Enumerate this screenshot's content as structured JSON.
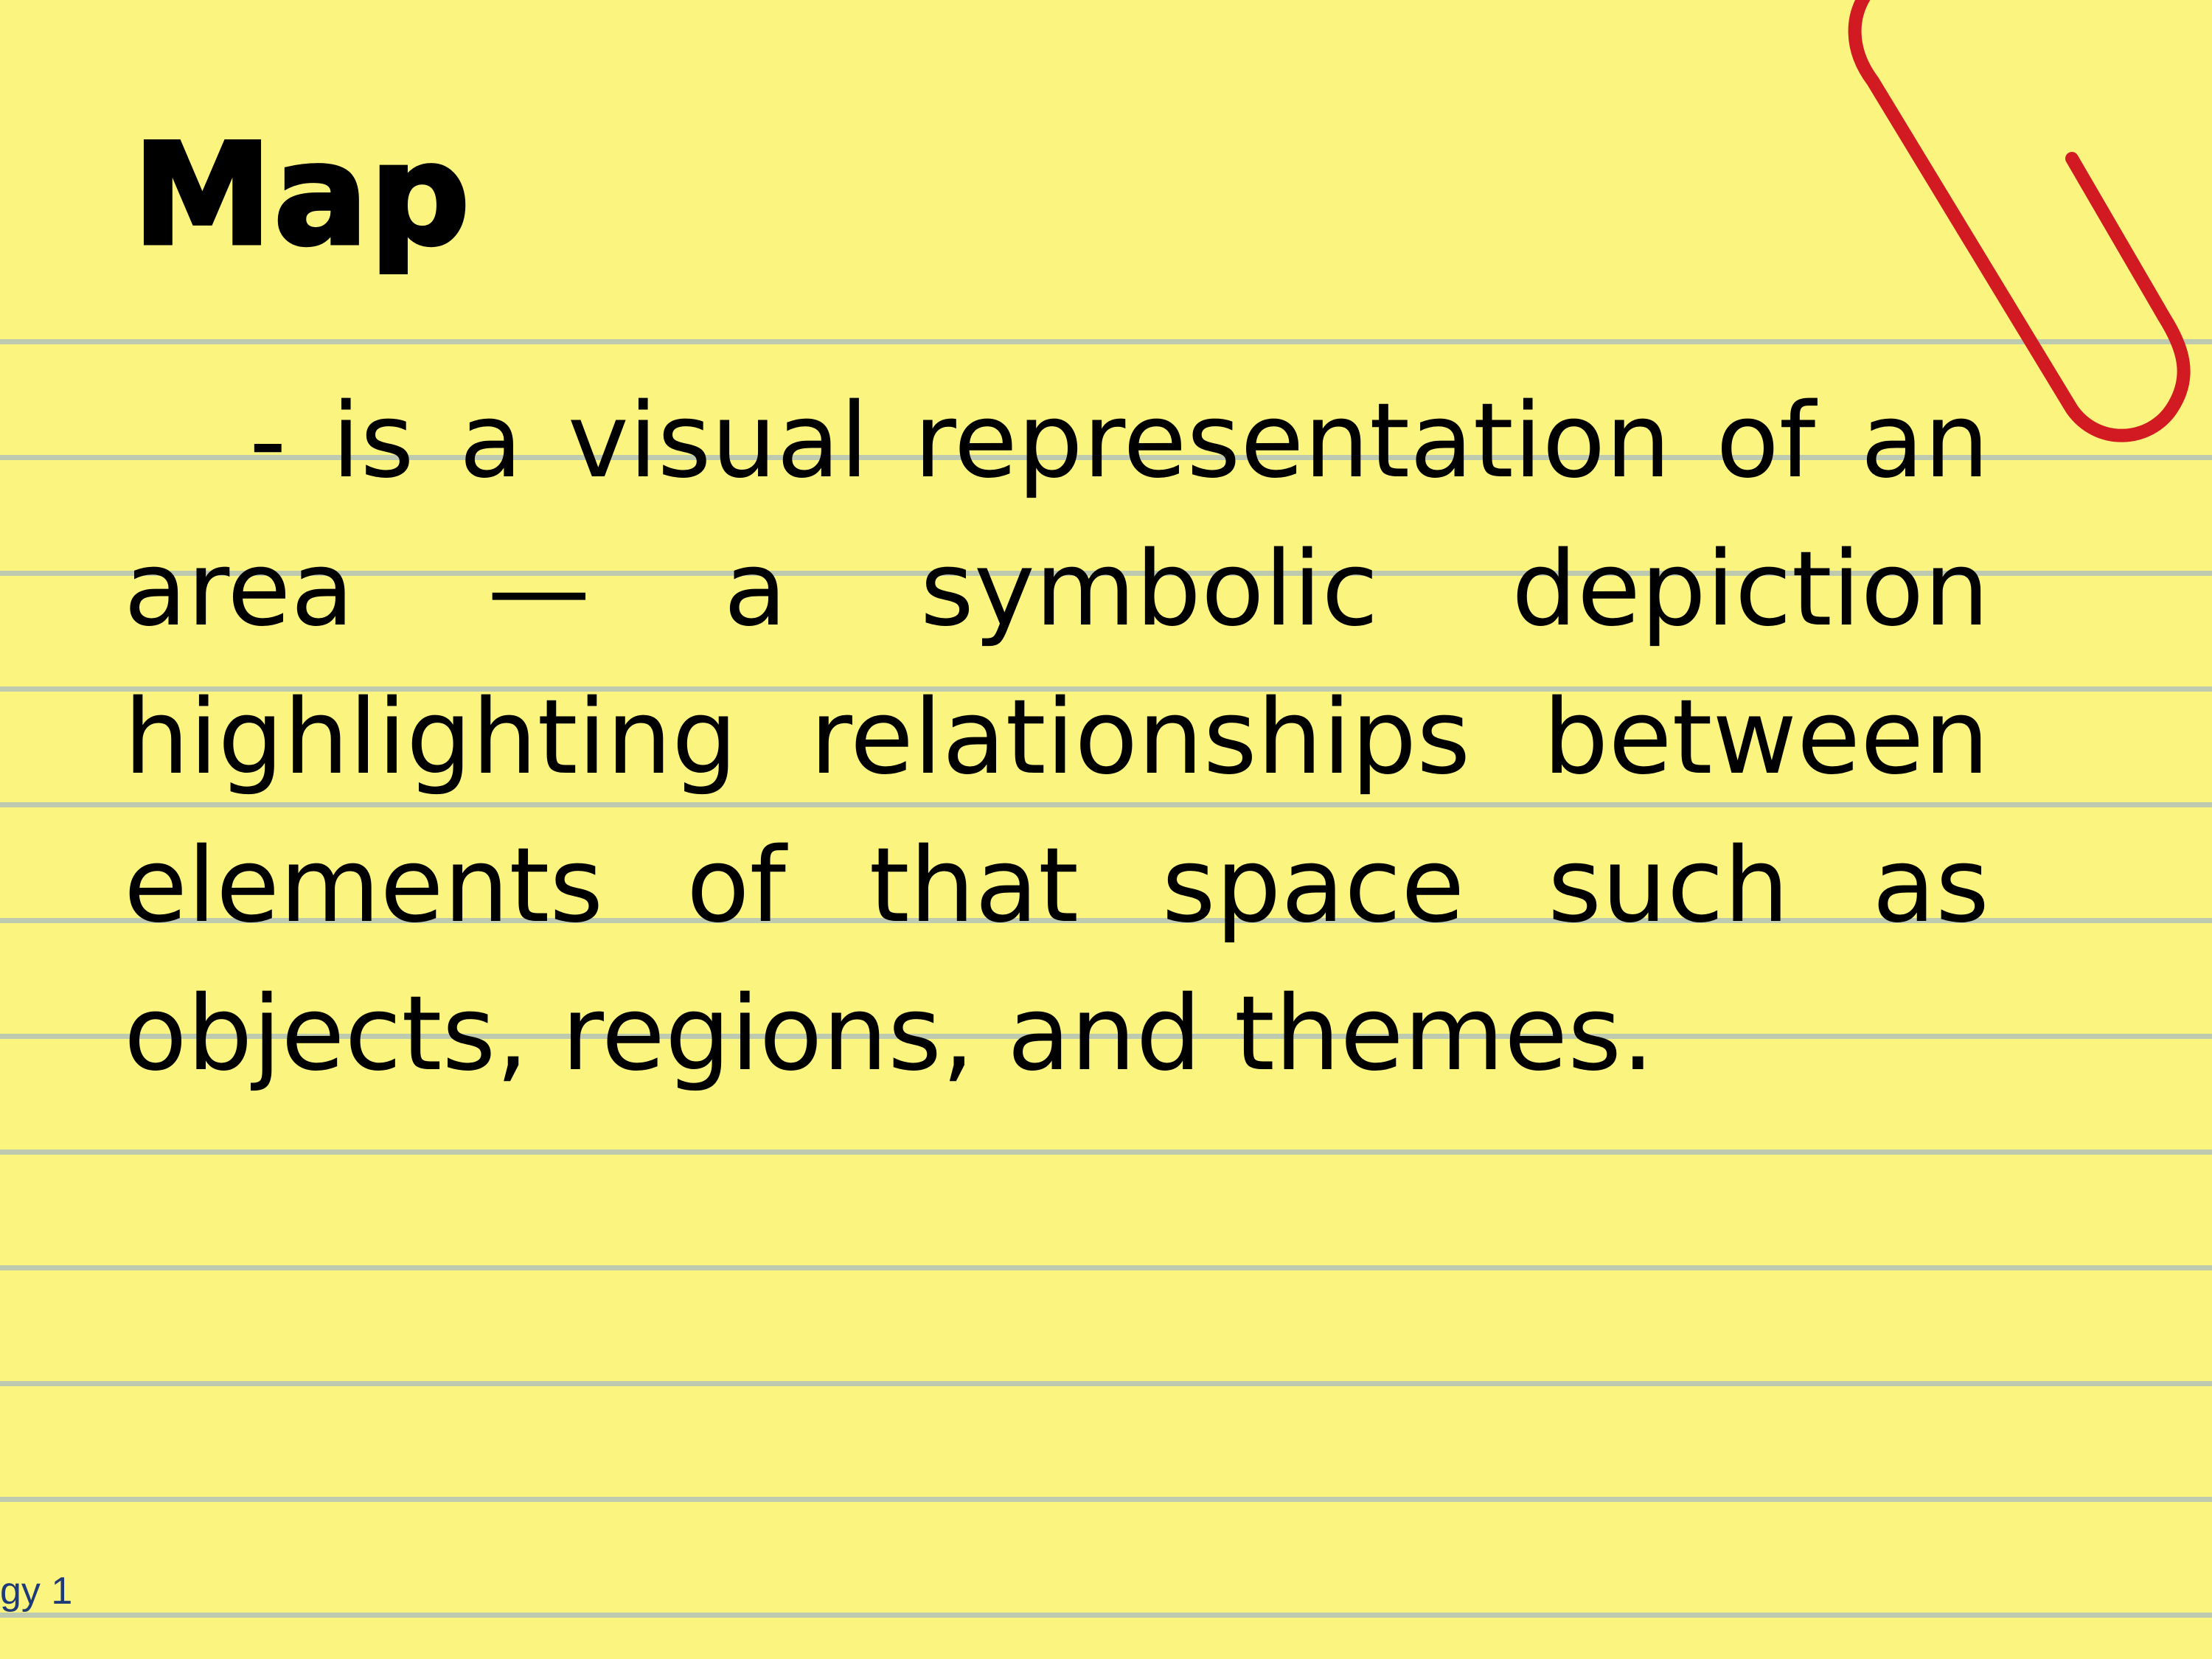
{
  "slide": {
    "title": "Map",
    "definition": "-  is a visual representation of an area — a symbolic depiction highlighting relationships between elements of that space such as objects, regions, and themes.",
    "footer": "gy 1"
  },
  "icons": {
    "paperclip": "paperclip-icon"
  },
  "colors": {
    "paper": "#fbf580",
    "rule_lines": "#b2c2b8",
    "paperclip": "#d11a22",
    "text": "#000000",
    "footer_text": "#1f3a78"
  }
}
